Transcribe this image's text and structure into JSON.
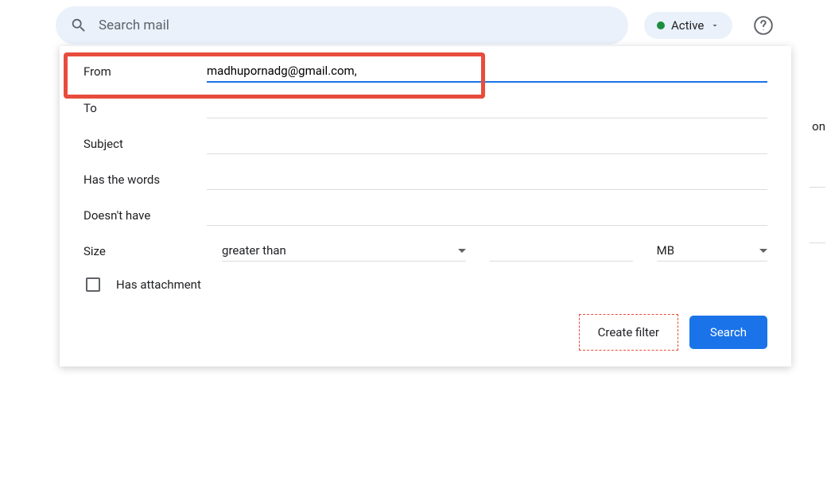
{
  "header": {
    "search_placeholder": "Search mail",
    "status_label": "Active"
  },
  "form": {
    "from": {
      "label": "From",
      "value": "madhupornadg@gmail.com,"
    },
    "to": {
      "label": "To",
      "value": ""
    },
    "subject": {
      "label": "Subject",
      "value": ""
    },
    "has_words": {
      "label": "Has the words",
      "value": ""
    },
    "doesnt_have": {
      "label": "Doesn't have",
      "value": ""
    },
    "size": {
      "label": "Size",
      "comparison": "greater than",
      "value": "",
      "unit": "MB"
    },
    "has_attachment": {
      "label": "Has attachment",
      "checked": false
    }
  },
  "buttons": {
    "create_filter": "Create filter",
    "search": "Search"
  },
  "background": {
    "partial_text": "on"
  }
}
